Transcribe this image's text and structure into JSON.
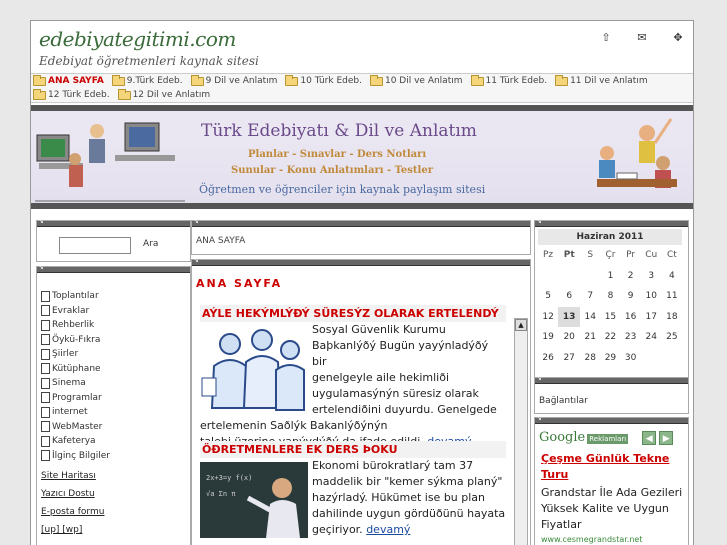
{
  "header": {
    "logo": "edebiyategitimi.com",
    "slogan": "Edebiyat öğretmenleri kaynak sitesi",
    "icons": [
      "home-icon",
      "mail-icon",
      "sitemap-icon"
    ]
  },
  "menu": {
    "row1": [
      "ANA SAYFA",
      "9.Türk Edeb.",
      "9 Dil ve Anlatım",
      "10 Türk Edeb.",
      "10 Dil ve Anlatım",
      "11 Türk Edeb.",
      "11 Dil ve Anlatım"
    ],
    "row2": [
      "12 Türk Edeb.",
      "12 Dil ve Anlatım"
    ]
  },
  "banner": {
    "title": "Türk Edebiyatı  &  Dil ve Anlatım",
    "sub1": "Planlar - Sınavlar - Ders Notları",
    "sub2": "Sunular - Konu Anlatımları - Testler",
    "sub3": "Öğretmen ve öğrenciler için kaynak paylaşım sitesi"
  },
  "search": {
    "button": "Ara",
    "placeholder": ""
  },
  "nav": [
    "Toplantılar",
    "Evraklar",
    "Rehberlik",
    "Öykü-Fıkra",
    "Şiirler",
    "Kütüphane",
    "Sinema",
    "Programlar",
    "internet",
    "WebMaster",
    "Kafeterya",
    "İlginç Bilgiler"
  ],
  "footlinks": [
    "Site Haritası",
    "Yazıcı Dostu",
    "E-posta formu",
    "[up] [wp]"
  ],
  "breadcrumb": "ANA SAYFA",
  "content": {
    "title": "ANA SAYFA",
    "news": [
      {
        "headline": "AÝLE HEKÝMLÝÐÝ SÜRESÝZ OLARAK ERTELENDÝ",
        "lines": [
          "Sosyal Güvenlik Kurumu",
          "Baþkanlýðý Bugün yayýnladýðý bir",
          "genelgeyle aile hekimliði",
          "uygulamasýnýn süresiz olarak",
          "ertelendiðini duyurdu. Genelgede",
          "ertelemenin Saðlýk Bakanlýðýnýn"
        ],
        "last": "talebi üzerine yapýydýðý da ifade edildi.",
        "more": "devamý"
      },
      {
        "headline": "ÖÐRETMENLERE EK DERS ÞOKU",
        "lines": [
          "Ekonomi bürokratlarý tam 37",
          "maddelik bir \"kemer sýkma planý\"",
          "hazýrladý. Hükümet ise bu plan",
          "dahilinde uygun gördüðünü hayata"
        ],
        "last": "geçiriyor.",
        "more": "devamý"
      }
    ]
  },
  "calendar": {
    "title": "Haziran 2011",
    "days": [
      "Pz",
      "Pt",
      "S",
      "Çr",
      "Pr",
      "Cu",
      "Ct"
    ],
    "weeks": [
      [
        "",
        "",
        "",
        "1",
        "2",
        "3",
        "4"
      ],
      [
        "5",
        "6",
        "7",
        "8",
        "9",
        "10",
        "11"
      ],
      [
        "12",
        "13",
        "14",
        "15",
        "16",
        "17",
        "18"
      ],
      [
        "19",
        "20",
        "21",
        "22",
        "23",
        "24",
        "25"
      ],
      [
        "26",
        "27",
        "28",
        "29",
        "30",
        "",
        ""
      ]
    ],
    "today": "13"
  },
  "links_label": "Bağlantılar",
  "ads": {
    "brand": "Google",
    "label": "Reklamları",
    "title1": "Çeşme Günlük Tekne",
    "title2": "Turu",
    "text": [
      "Grandstar İle Ada Gezileri",
      "Yüksek Kalite ve Uygun",
      "Fiyatlar"
    ],
    "url": "www.cesmegrandstar.net"
  }
}
